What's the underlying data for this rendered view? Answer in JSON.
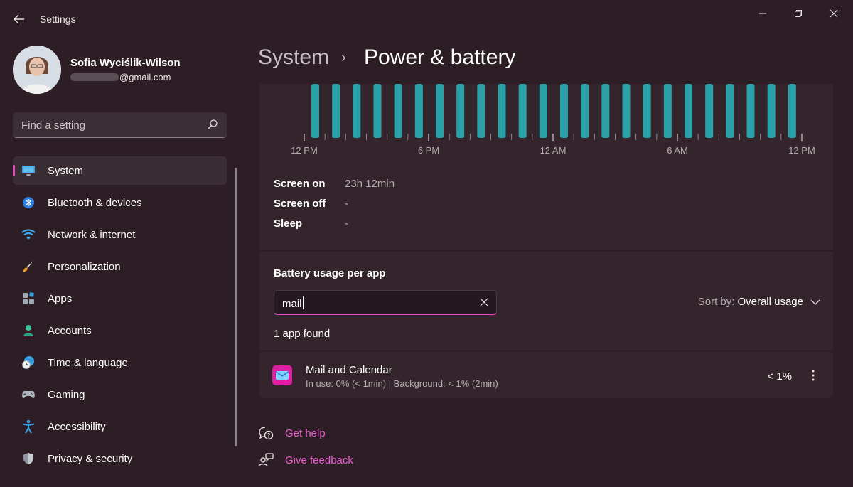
{
  "window": {
    "app_title": "Settings",
    "back_icon": "back-arrow-icon",
    "controls": [
      "minimize-icon",
      "maximize-icon",
      "close-icon"
    ]
  },
  "profile": {
    "name": "Sofia Wyciślik-Wilson",
    "email_visible": "@gmail.com"
  },
  "search": {
    "placeholder": "Find a setting"
  },
  "sidebar": {
    "items": [
      {
        "label": "System",
        "icon": "monitor-icon",
        "selected": true
      },
      {
        "label": "Bluetooth & devices",
        "icon": "bluetooth-icon"
      },
      {
        "label": "Network & internet",
        "icon": "wifi-icon"
      },
      {
        "label": "Personalization",
        "icon": "paintbrush-icon"
      },
      {
        "label": "Apps",
        "icon": "apps-icon"
      },
      {
        "label": "Accounts",
        "icon": "person-icon"
      },
      {
        "label": "Time & language",
        "icon": "clock-globe-icon"
      },
      {
        "label": "Gaming",
        "icon": "gamepad-icon"
      },
      {
        "label": "Accessibility",
        "icon": "accessibility-icon"
      },
      {
        "label": "Privacy & security",
        "icon": "shield-icon"
      }
    ],
    "accent_color": "#e34bb6"
  },
  "header": {
    "parent": "System",
    "separator": "›",
    "current": "Power & battery"
  },
  "usage_chart": {
    "tick_labels": [
      "12 PM",
      "6 PM",
      "12 AM",
      "6 AM",
      "12 PM"
    ],
    "bar_color": "#2aa1a6",
    "bars": 24
  },
  "stats": [
    {
      "label": "Screen on",
      "value": "23h 12min"
    },
    {
      "label": "Screen off",
      "value": "-"
    },
    {
      "label": "Sleep",
      "value": "-"
    }
  ],
  "battery_usage": {
    "title": "Battery usage per app",
    "filter_value": "mail",
    "sort_label": "Sort by:",
    "sort_value": "Overall usage",
    "found_text": "1 app found"
  },
  "apps": [
    {
      "name": "Mail and Calendar",
      "detail": "In use: 0% (< 1min) | Background: < 1% (2min)",
      "usage": "< 1%",
      "icon": "mail-icon"
    }
  ],
  "footer": {
    "help_label": "Get help",
    "feedback_label": "Give feedback"
  }
}
